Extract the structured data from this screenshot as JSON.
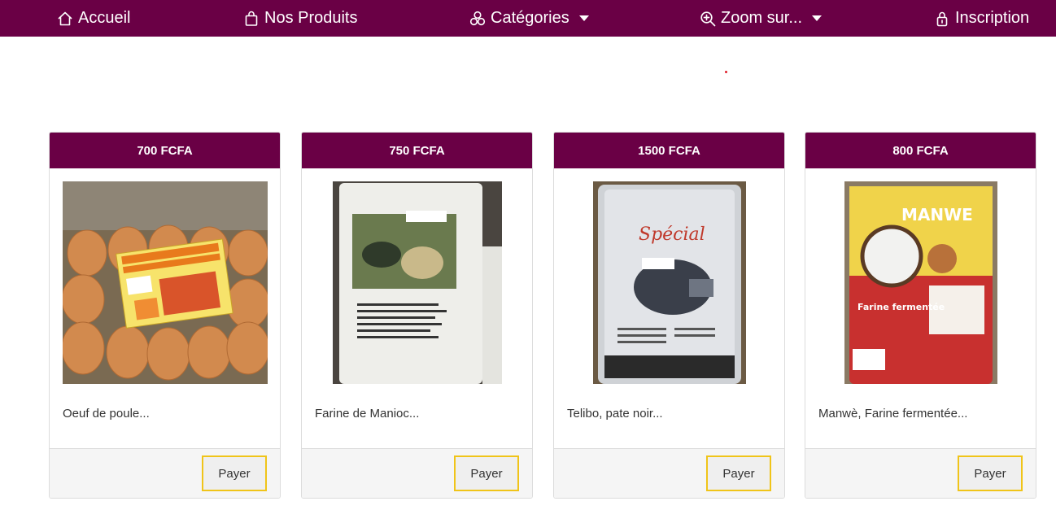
{
  "nav": {
    "home": {
      "label": "Accueil",
      "icon": "home-icon"
    },
    "products": {
      "label": "Nos Produits",
      "icon": "shopping-bag-icon"
    },
    "categories": {
      "label": "Catégories",
      "icon": "boxes-icon"
    },
    "zoom": {
      "label": "Zoom sur...",
      "icon": "zoom-in-icon"
    },
    "signup": {
      "label": "Inscription",
      "icon": "lock-icon"
    }
  },
  "colors": {
    "brand": "#6a0045",
    "button_border": "#f0c419"
  },
  "products": [
    {
      "price": "700 FCFA",
      "name": "Oeuf de poule...",
      "button": "Payer",
      "image": "eggs-carton-photo"
    },
    {
      "price": "750 FCFA",
      "name": "Farine de Manioc...",
      "button": "Payer",
      "image": "cassava-flour-bag-photo"
    },
    {
      "price": "1500 FCFA",
      "name": "Telibo, pate noir...",
      "button": "Payer",
      "image": "telibo-pouch-photo"
    },
    {
      "price": "800 FCFA",
      "name": "Manwè, Farine fermentée...",
      "button": "Payer",
      "image": "manwe-flour-bag-photo"
    }
  ]
}
